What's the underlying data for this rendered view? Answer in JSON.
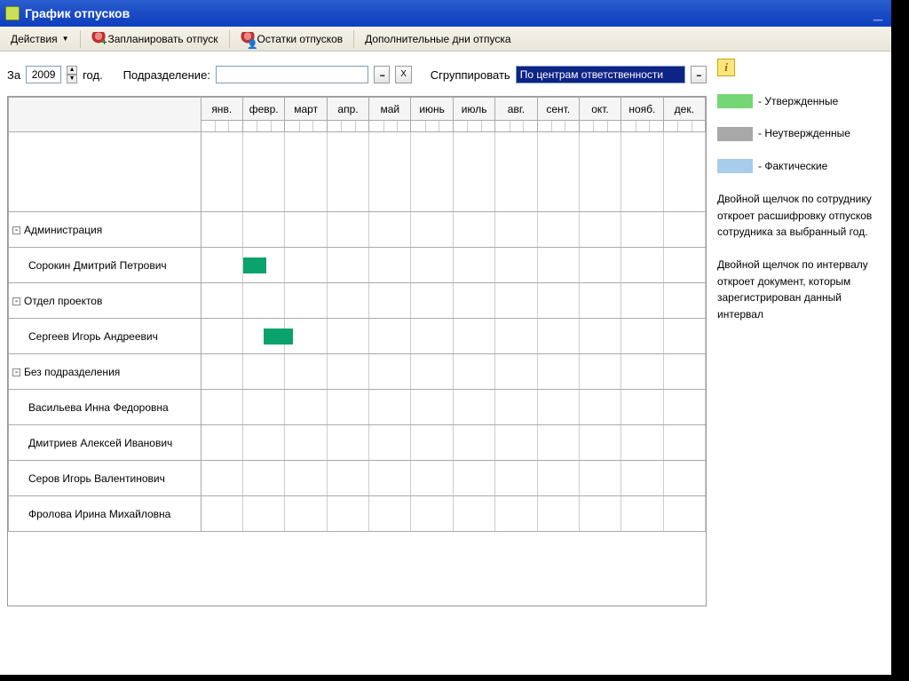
{
  "window": {
    "title": "График отпусков"
  },
  "toolbar": {
    "actions": "Действия",
    "plan": "Запланировать отпуск",
    "remains": "Остатки отпусков",
    "extra_days": "Дополнительные дни отпуска"
  },
  "filterbar": {
    "za": "За",
    "year": "2009",
    "year_label": "год.",
    "dep_label": "Подразделение:",
    "group_label": "Сгруппировать",
    "group_value": "По центрам ответственности",
    "x": "X",
    "dots": "..."
  },
  "months": [
    "янв.",
    "февр.",
    "март",
    "апр.",
    "май",
    "июнь",
    "июль",
    "авг.",
    "сент.",
    "окт.",
    "нояб.",
    "дек."
  ],
  "rows": [
    {
      "type": "dept",
      "name": "Администрация"
    },
    {
      "type": "emp",
      "name": "Сорокин Дмитрий Петрович",
      "bar_month": 1,
      "bar_width": 0.55
    },
    {
      "type": "dept",
      "name": "Отдел проектов"
    },
    {
      "type": "emp",
      "name": "Сергеев Игорь Андреевич",
      "bar_month": 1,
      "bar_offset": 0.5,
      "bar_width": 0.7
    },
    {
      "type": "dept",
      "name": "Без подразделения"
    },
    {
      "type": "emp",
      "name": "Васильева Инна Федоровна"
    },
    {
      "type": "emp",
      "name": "Дмитриев Алексей Иванович"
    },
    {
      "type": "emp",
      "name": "Серов Игорь Валентинович"
    },
    {
      "type": "emp",
      "name": "Фролова Ирина Михайловна"
    }
  ],
  "legend": {
    "approved": "- Утвержденные",
    "not_approved": "- Неутвержденные",
    "actual": "- Фактические"
  },
  "help": {
    "line1": "Двойной щелчок по сотруднику откроет расшифровку отпусков сотрудника за выбранный год.",
    "line2": "Двойной щелчок по интервалу откроет документ, которым зарегистрирован данный интервал"
  },
  "info_symbol": "i",
  "expander_symbol": "-"
}
